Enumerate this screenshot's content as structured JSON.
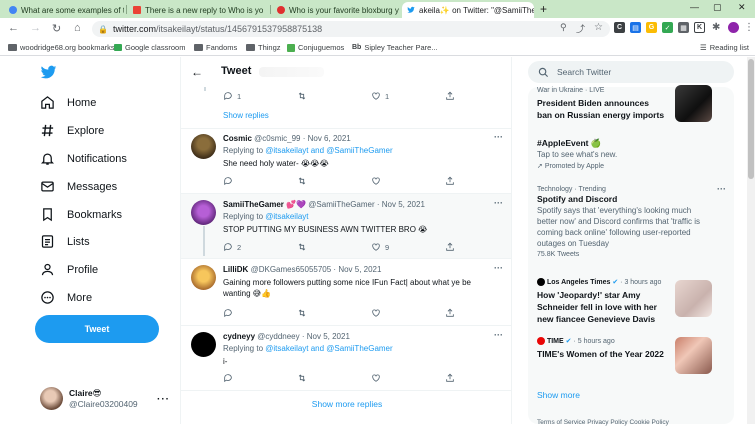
{
  "browser": {
    "tabs": [
      {
        "title": "What are some examples of the",
        "icon": "google-icon",
        "color": "#4285f4"
      },
      {
        "title": "There is a new reply to Who is yo",
        "icon": "gmail-icon",
        "color": "#ea4335"
      },
      {
        "title": "Who is your favorite bloxburg y",
        "icon": "quiz-icon",
        "color": "#e0302f"
      },
      {
        "title": "akeila✨ on Twitter: \"@SamiiThe",
        "icon": "twitter-icon",
        "color": "#1d9bf0"
      }
    ],
    "url_domain": "twitter.com",
    "url_path": "/itsakeilayt/status/1456791537958875138",
    "bookmarks": [
      {
        "label": "woodridge68.org bookmarks"
      },
      {
        "label": "Google classroom"
      },
      {
        "label": "Fandoms"
      },
      {
        "label": "Thingz"
      },
      {
        "label": "Conjuguemos"
      },
      {
        "label": "Sipley Teacher Pare..."
      }
    ],
    "reading_list": "Reading list"
  },
  "sidebar": {
    "items": [
      {
        "label": "Home",
        "icon": "home-icon"
      },
      {
        "label": "Explore",
        "icon": "hashtag-icon"
      },
      {
        "label": "Notifications",
        "icon": "bell-icon"
      },
      {
        "label": "Messages",
        "icon": "mail-icon"
      },
      {
        "label": "Bookmarks",
        "icon": "bookmark-icon"
      },
      {
        "label": "Lists",
        "icon": "list-icon"
      },
      {
        "label": "Profile",
        "icon": "person-icon"
      },
      {
        "label": "More",
        "icon": "more-circle-icon"
      }
    ],
    "tweet_button": "Tweet",
    "user": {
      "name": "Claire😎",
      "handle": "@Claire03200409"
    }
  },
  "main": {
    "title": "Tweet",
    "first_actions": {
      "replies": "1",
      "retweets": "",
      "likes": "1"
    },
    "show_replies": "Show replies",
    "tweets": [
      {
        "name": "Cosmic",
        "handle": "@c0smic_99",
        "date": "Nov 6, 2021",
        "replying_prefix": "Replying to",
        "replying_to": "@itsakeilayt and @SamiiTheGamer",
        "text": "She need holy water- 😭😭😭",
        "replies": "",
        "likes": ""
      },
      {
        "name": "SamiiTheGamer 💕💜",
        "handle": "@SamiiTheGamer",
        "date": "Nov 5, 2021",
        "replying_prefix": "Replying to",
        "replying_to": "@itsakeilayt",
        "text": "STOP PUTTING MY BUSINESS AWN TWITTER BRO 😭",
        "replies": "2",
        "likes": "9"
      },
      {
        "name": "LilliDK",
        "handle": "@DKGames65055705",
        "date": "Nov 5, 2021",
        "replying_prefix": "",
        "replying_to": "",
        "text": "Gaining more followers putting some nice IFun Fact| about what ye be wanting 😅👍",
        "replies": "",
        "likes": ""
      },
      {
        "name": "cydneyy",
        "handle": "@cyddneey",
        "date": "Nov 5, 2021",
        "replying_prefix": "Replying to",
        "replying_to": "@itsakeilayt and @SamiiTheGamer",
        "text": "i-",
        "replies": "",
        "likes": ""
      }
    ],
    "show_more_replies": "Show more replies"
  },
  "right": {
    "search_placeholder": "Search Twitter",
    "trends": [
      {
        "sub": "War in Ukraine · LIVE",
        "head": "President Biden announces ban on Russian energy imports"
      },
      {
        "sub": "",
        "head": "#AppleEvent 🍏",
        "desc": "Tap to see what's new.",
        "promo": "Promoted by Apple"
      },
      {
        "sub": "Technology · Trending",
        "head": "Spotify and Discord",
        "desc": "Spotify says that 'everything's looking much better now' and Discord confirms that 'traffic is coming back online' following user-reported outages on Tuesday",
        "count": "75.8K Tweets"
      },
      {
        "source": "Los Angeles Times",
        "time": "3 hours ago",
        "head": "How 'Jeopardy!' star Amy Schneider fell in love with her new fiancee Genevieve Davis"
      },
      {
        "source": "TIME",
        "time": "5 hours ago",
        "head": "TIME's Women of the Year 2022"
      }
    ],
    "show_more": "Show more",
    "footer": "Terms of Service   Privacy Policy   Cookie Policy"
  },
  "colors": {
    "accent": "#1d9bf0",
    "tab_strip": "#c9e7c7"
  }
}
